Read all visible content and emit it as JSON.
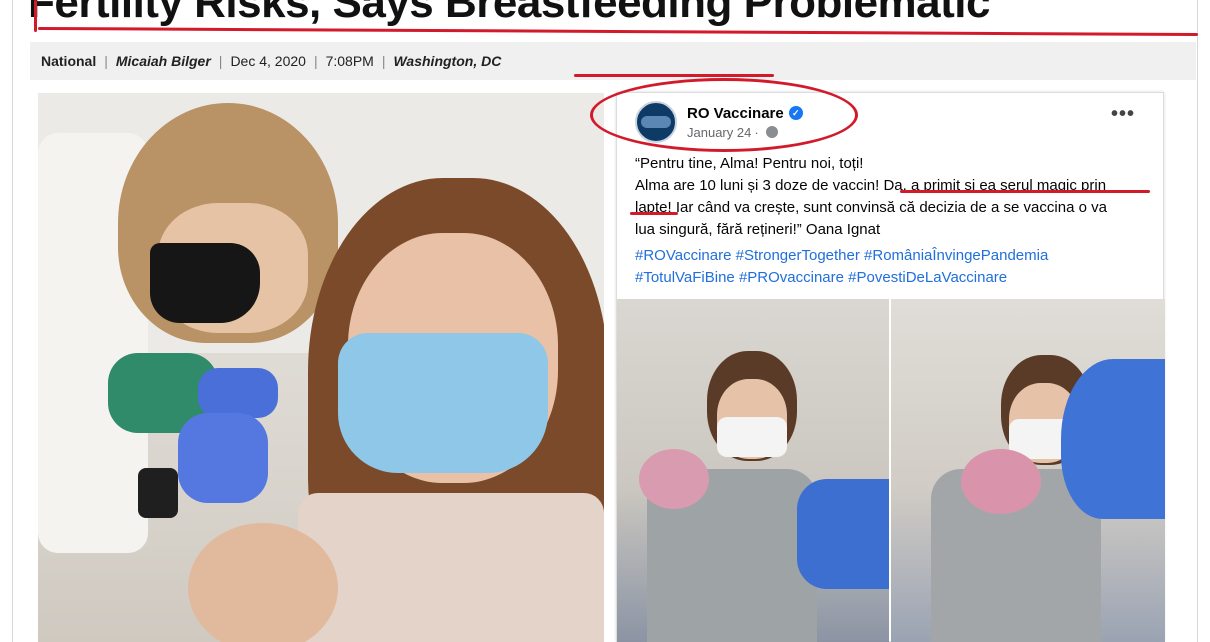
{
  "article": {
    "headline": "Fertility Risks, Says Breastfeeding Problematic",
    "byline": {
      "section": "National",
      "author": "Micaiah Bilger",
      "date": "Dec 4, 2020",
      "time": "7:08PM",
      "location": "Washington, DC"
    }
  },
  "fb_post": {
    "page_name": "RO Vaccinare",
    "date": "January 24",
    "text_line1": "“Pentru tine, Alma! Pentru noi, toți!",
    "text_line2": "Alma are 10 luni și 3 doze de vaccin! Da, a primit și ea serul magic prin",
    "text_line3": "lapte! Iar când va crește, sunt convinsă că decizia de a se vaccina o va",
    "text_line4": "lua singură, fără rețineri!” Oana Ignat",
    "hashtags_line1": "#ROVaccinare #StrongerTogether #RomâniaÎnvingePandemia",
    "hashtags_line2": "#TotulVaFiBine #PROvaccinare #PovestiDeLaVaccinare",
    "more_label": "•••"
  },
  "icons": {
    "verified": "verified-badge-icon",
    "privacy": "globe-icon",
    "more": "more-options-icon"
  },
  "colors": {
    "annotation_red": "#d21a2b",
    "hashtag_blue": "#216fdb",
    "verified_blue": "#1877f2"
  }
}
